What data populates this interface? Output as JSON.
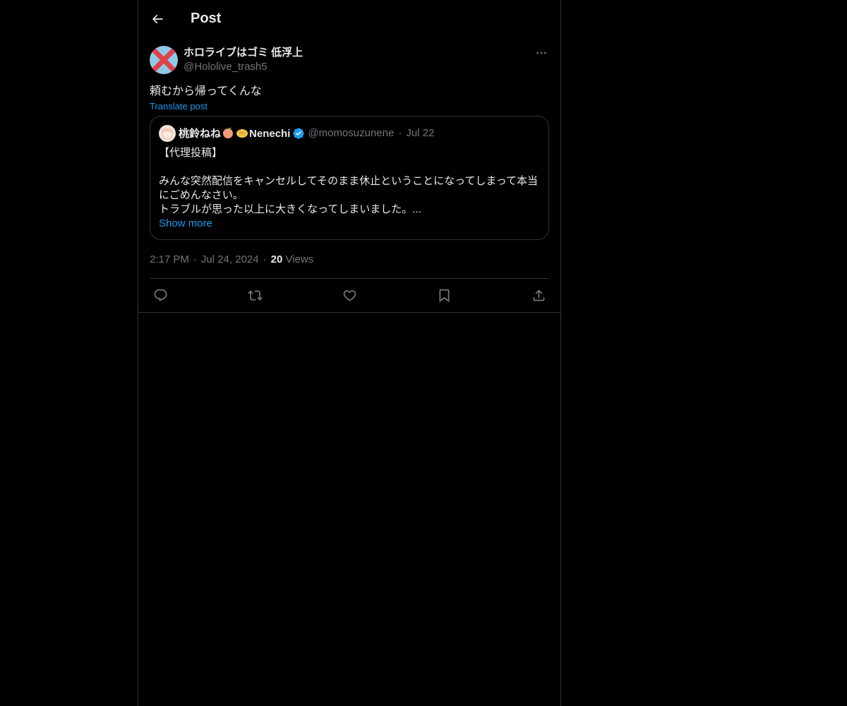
{
  "header": {
    "title": "Post"
  },
  "post": {
    "author": {
      "display_name": "ホロライブはゴミ 低浮上",
      "handle": "@Hololive_trash5"
    },
    "text": "頼むから帰ってくんな",
    "translate_label": "Translate post",
    "quote": {
      "display_name": "桃鈴ねね",
      "display_name_suffix": "Nenechi",
      "handle": "@momosuzunene",
      "dot": "·",
      "date": "Jul 22",
      "body": "【代理投稿】\n\nみんな突然配信をキャンセルしてそのまま休止ということになってしまって本当にごめんなさい。\nトラブルが思った以上に大きくなってしまいました。...",
      "show_more": "Show more"
    },
    "time": "2:17 PM",
    "sep": "·",
    "date": "Jul 24, 2024",
    "views_count": "20",
    "views_label": "Views"
  },
  "colors": {
    "background": "#000000",
    "text": "#e7e9ea",
    "secondary": "#71767b",
    "accent": "#1d9bf0",
    "border": "#2f3336"
  },
  "icons": [
    "back-arrow-icon",
    "more-icon",
    "verified-icon",
    "peach-emoji-icon",
    "melon-pan-emoji-icon",
    "reply-icon",
    "repost-icon",
    "like-icon",
    "bookmark-icon",
    "share-icon"
  ]
}
